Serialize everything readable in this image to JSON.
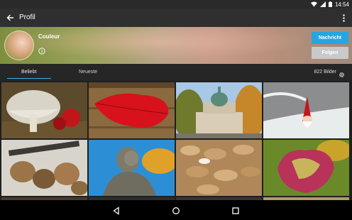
{
  "status_bar": {
    "time": "14:54"
  },
  "app_bar": {
    "title": "Profil",
    "back_icon": "arrow-back-icon",
    "overflow_icon": "more-vert-icon"
  },
  "profile": {
    "name": "Couleur",
    "info_icon": "info-icon"
  },
  "actions": {
    "message_label": "Nachricht",
    "follow_label": "Folgen"
  },
  "tabs": {
    "items": [
      {
        "label": "Beliebt",
        "active": true
      },
      {
        "label": "Neueste",
        "active": false
      }
    ],
    "count": "822 Bilder",
    "accent": "#3ab0e8"
  },
  "colors": {
    "message_button": "#23a6e3",
    "follow_button": "#c9c9c9"
  },
  "gallery": {
    "tiles": [
      {
        "name": "mushroom-photo"
      },
      {
        "name": "red-leaf-photo"
      },
      {
        "name": "domed-building-photo"
      },
      {
        "name": "winter-gnome-photo"
      },
      {
        "name": "walnuts-photo"
      },
      {
        "name": "statue-photo"
      },
      {
        "name": "peanuts-photo"
      },
      {
        "name": "vine-leaf-photo"
      }
    ]
  },
  "nav_bar": {
    "back": "nav-back-icon",
    "home": "nav-home-icon",
    "recents": "nav-recents-icon"
  }
}
